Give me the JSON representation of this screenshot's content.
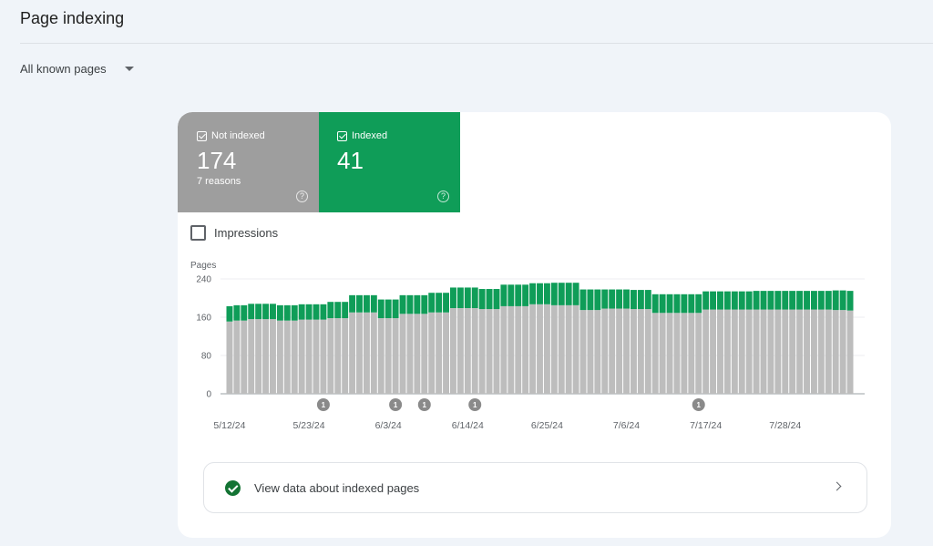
{
  "header": {
    "title": "Page indexing"
  },
  "filter": {
    "selected": "All known pages"
  },
  "metrics": {
    "not_indexed": {
      "label": "Not indexed",
      "value": "174",
      "sub": "7 reasons",
      "checked": true,
      "color": "#9e9e9e"
    },
    "indexed": {
      "label": "Indexed",
      "value": "41",
      "checked": true,
      "color": "#0f9d58"
    },
    "help_glyph": "?"
  },
  "impressions": {
    "label": "Impressions",
    "checked": false
  },
  "view_data": {
    "label": "View data about indexed pages",
    "icon": "check-circle-icon",
    "chevron": "chevron-right-icon"
  },
  "chart_data": {
    "type": "bar",
    "stacked": true,
    "ylabel": "Pages",
    "ylim": [
      0,
      240
    ],
    "yticks": [
      0,
      80,
      160,
      240
    ],
    "grid": true,
    "start_date": "5/12/24",
    "x_tick_labels": [
      "5/12/24",
      "5/23/24",
      "6/3/24",
      "6/14/24",
      "6/25/24",
      "7/6/24",
      "7/17/24",
      "7/28/24"
    ],
    "x_tick_indices": [
      0,
      11,
      22,
      33,
      44,
      55,
      66,
      77
    ],
    "series": [
      {
        "name": "Not indexed",
        "color": "#bdbdbd",
        "values": [
          151,
          153,
          153,
          156,
          156,
          156,
          156,
          153,
          153,
          153,
          155,
          155,
          155,
          155,
          158,
          158,
          158,
          170,
          170,
          170,
          170,
          158,
          158,
          158,
          167,
          167,
          167,
          167,
          170,
          170,
          170,
          179,
          179,
          179,
          179,
          177,
          177,
          177,
          183,
          183,
          183,
          183,
          187,
          187,
          187,
          185,
          185,
          185,
          185,
          175,
          175,
          175,
          178,
          178,
          178,
          178,
          177,
          177,
          177,
          169,
          169,
          169,
          169,
          169,
          169,
          169,
          176,
          176,
          176,
          176,
          176,
          176,
          176,
          176,
          176,
          176,
          176,
          176,
          176,
          176,
          176,
          176,
          176,
          176,
          175,
          175,
          174
        ]
      },
      {
        "name": "Indexed",
        "color": "#0f9d58",
        "values": [
          32,
          32,
          32,
          32,
          32,
          32,
          32,
          32,
          32,
          32,
          32,
          32,
          32,
          32,
          34,
          34,
          34,
          36,
          36,
          36,
          36,
          39,
          39,
          39,
          39,
          39,
          39,
          39,
          41,
          41,
          41,
          43,
          43,
          43,
          43,
          42,
          42,
          42,
          45,
          45,
          45,
          45,
          44,
          44,
          44,
          47,
          47,
          47,
          47,
          43,
          43,
          43,
          40,
          40,
          40,
          40,
          40,
          40,
          40,
          39,
          39,
          39,
          39,
          39,
          39,
          39,
          38,
          38,
          38,
          38,
          38,
          38,
          38,
          39,
          39,
          39,
          39,
          39,
          39,
          39,
          39,
          39,
          39,
          39,
          41,
          41,
          41
        ]
      }
    ],
    "annotations": [
      {
        "index": 13,
        "label": "1"
      },
      {
        "index": 23,
        "label": "1"
      },
      {
        "index": 27,
        "label": "1"
      },
      {
        "index": 34,
        "label": "1"
      },
      {
        "index": 65,
        "label": "1"
      }
    ]
  }
}
